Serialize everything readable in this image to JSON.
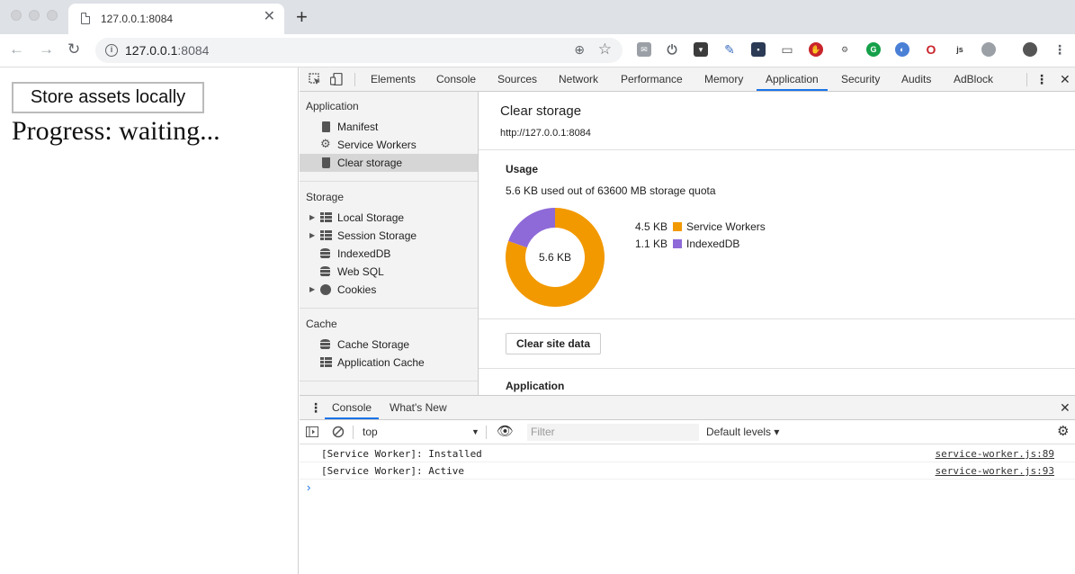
{
  "browser": {
    "tab_title": "127.0.0.1:8084",
    "tab_close": "✕",
    "new_tab": "+",
    "url_host": "127.0.0.1",
    "url_port": ":8084"
  },
  "page": {
    "store_button": "Store assets locally",
    "progress_text": "Progress: waiting..."
  },
  "devtools": {
    "tabs": [
      "Elements",
      "Console",
      "Sources",
      "Network",
      "Performance",
      "Memory",
      "Application",
      "Security",
      "Audits",
      "AdBlock"
    ],
    "active_tab": "Application",
    "sidebar": {
      "application_header": "Application",
      "application_items": [
        "Manifest",
        "Service Workers",
        "Clear storage"
      ],
      "selected_item": "Clear storage",
      "storage_header": "Storage",
      "storage_items": [
        "Local Storage",
        "Session Storage",
        "IndexedDB",
        "Web SQL",
        "Cookies"
      ],
      "cache_header": "Cache",
      "cache_items": [
        "Cache Storage",
        "Application Cache"
      ]
    },
    "main": {
      "title": "Clear storage",
      "origin": "http://127.0.0.1:8084",
      "usage_header": "Usage",
      "usage_quota": "5.6 KB used out of 63600 MB storage quota",
      "donut_center": "5.6 KB",
      "legend": [
        {
          "value": "4.5 KB",
          "label": "Service Workers",
          "color": "#f29900"
        },
        {
          "value": "1.1 KB",
          "label": "IndexedDB",
          "color": "#8e6ad8"
        }
      ],
      "clear_button": "Clear site data",
      "application_header": "Application"
    },
    "drawer": {
      "tabs": [
        "Console",
        "What's New"
      ],
      "context": "top",
      "filter_placeholder": "Filter",
      "levels": "Default levels ▾",
      "messages": [
        {
          "text": "[Service Worker]: Installed",
          "source": "service-worker.js:89"
        },
        {
          "text": "[Service Worker]: Active",
          "source": "service-worker.js:93"
        }
      ],
      "prompt": "›"
    }
  }
}
